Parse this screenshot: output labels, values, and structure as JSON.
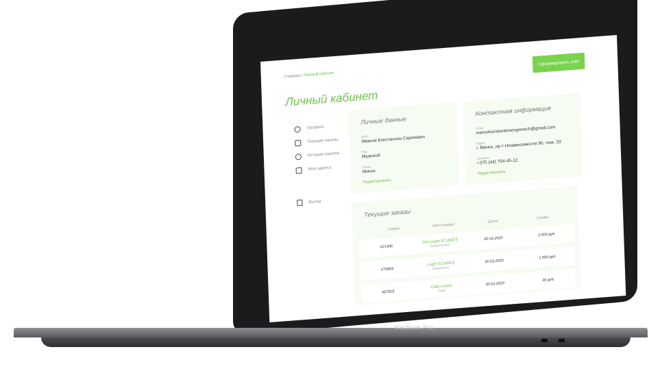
{
  "laptop": {
    "brand": "MacBook Pro"
  },
  "breadcrumbs": [
    {
      "label": "Главная"
    },
    {
      "label": "/"
    },
    {
      "label": "Личный кабинет"
    }
  ],
  "cta_label": "Сформировать счет",
  "page_title": "Личный кабинет",
  "sidebar": {
    "items": [
      {
        "label": "Профиль",
        "icon": "user-icon"
      },
      {
        "label": "Текущие заказы",
        "icon": "list-icon"
      },
      {
        "label": "История заказов",
        "icon": "history-icon"
      },
      {
        "label": "Мои адреса",
        "icon": "address-book-icon"
      }
    ],
    "logout": {
      "label": "Выход",
      "icon": "logout-icon"
    }
  },
  "personal": {
    "title": "Личные данные",
    "fields": [
      {
        "label": "ФИО",
        "value": "Иванов Константин Сергеевич"
      },
      {
        "label": "Пол",
        "value": "Мужской"
      },
      {
        "label": "Город",
        "value": "Минск"
      }
    ],
    "edit": "Редактировать"
  },
  "contact": {
    "title": "Контактная информация",
    "fields": [
      {
        "label": "Email",
        "value": "ivanovkonstantinsergeevich@gmail.com"
      },
      {
        "label": "Адрес",
        "value": "г. Минск, пр-т Независимости 90, пом. 33"
      },
      {
        "label": "Телефон",
        "value": "+375 (44) 754-45-12"
      }
    ],
    "edit": "Редактировать"
  },
  "orders": {
    "title": "Текущие заказы",
    "columns": [
      "Номер",
      "Имя товара",
      "Дата",
      "Сумма"
    ],
    "rows": [
      {
        "number": "#21356",
        "name": "DeLonghi ECAM23",
        "category": "Кофемашина",
        "date": "30.03.2020",
        "sum": "2.500 руб."
      },
      {
        "number": "#75894",
        "name": "Loghi ECAM23",
        "category": "Кофемолка",
        "date": "30.03.2020",
        "sum": "1.500 руб."
      },
      {
        "number": "#67916",
        "name": "Cafe cream",
        "category": "Кофе",
        "date": "30.03.2020",
        "sum": "30 руб."
      }
    ]
  },
  "colors": {
    "accent": "#6fc24b",
    "button": "#7ad34f",
    "card_bg": "#f7fcf3"
  }
}
